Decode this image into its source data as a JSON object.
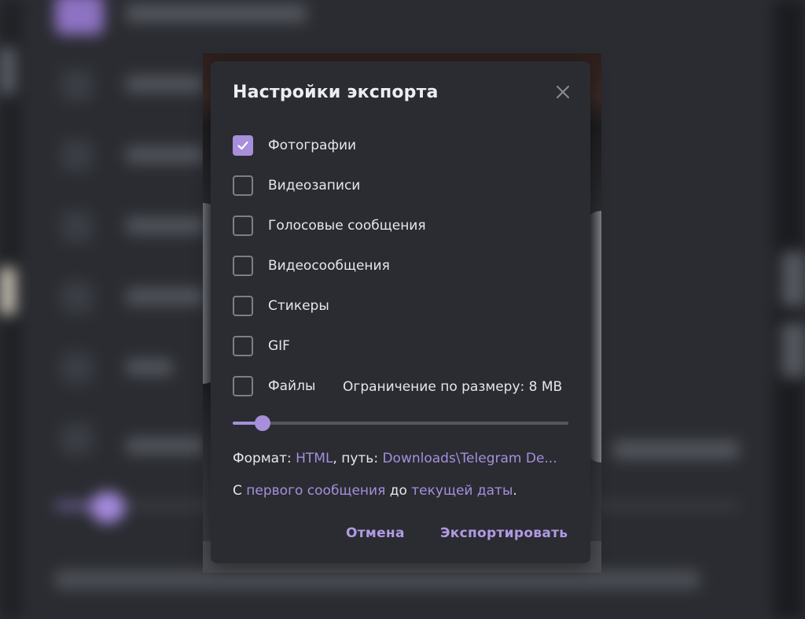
{
  "dialog": {
    "title": "Настройки экспорта",
    "close_icon": "close-icon"
  },
  "options": [
    {
      "label": "Фотографии",
      "checked": true
    },
    {
      "label": "Видеозаписи",
      "checked": false
    },
    {
      "label": "Голосовые сообщения",
      "checked": false
    },
    {
      "label": "Видеосообщения",
      "checked": false
    },
    {
      "label": "Стикеры",
      "checked": false
    },
    {
      "label": "GIF",
      "checked": false
    },
    {
      "label": "Файлы",
      "checked": false
    }
  ],
  "size_limit": {
    "label": "Ограничение по размеру: 8 MB",
    "slider_fraction": 0.09
  },
  "format_line": {
    "prefix": "Формат: ",
    "format": "HTML",
    "path_prefix": ", путь: ",
    "path": "Downloads\\Telegram De..."
  },
  "range_line": {
    "prefix": "С ",
    "from": "первого сообщения",
    "middle": " до ",
    "to": "текущей даты",
    "suffix": "."
  },
  "buttons": {
    "cancel": "Отмена",
    "export": "Экспортировать"
  },
  "colors": {
    "accent": "#a78fdb",
    "dialog_bg": "#2a2c32",
    "text": "#e6e7ea"
  }
}
